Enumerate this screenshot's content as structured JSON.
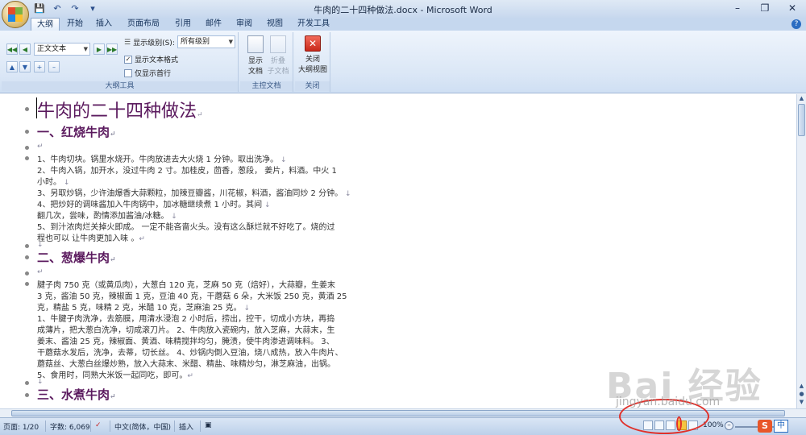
{
  "window": {
    "title": "牛肉的二十四种做法.docx - Microsoft Word",
    "qat": [
      "save-icon",
      "undo-icon",
      "redo-icon",
      "customize-icon"
    ]
  },
  "tabs": [
    "大纲",
    "开始",
    "插入",
    "页面布局",
    "引用",
    "邮件",
    "审阅",
    "视图",
    "开发工具"
  ],
  "ribbon": {
    "outline_tools": {
      "label": "大纲工具",
      "level_combo": "正文文本",
      "show_level_label": "显示级别(S):",
      "show_level_value": "所有级别",
      "show_text_format": "显示文本格式",
      "show_first_line": "仅显示首行"
    },
    "master_document": {
      "label": "主控文档",
      "show_document_line1": "显示",
      "show_document_line2": "文档",
      "collapse_line1": "折叠",
      "collapse_line2": "子文档"
    },
    "close": {
      "label": "关闭",
      "close_outline_line1": "关闭",
      "close_outline_line2": "大纲视图"
    }
  },
  "document": {
    "title": "牛肉的二十四种做法",
    "section1_heading": "一、红烧牛肉",
    "section1_lines": [
      "1、牛肉切块。锅里水烧开。牛肉放进去大火烧 1 分钟。取出洗净。",
      "2、牛肉入锅，加开水，没过牛肉 2 寸。加桂皮，茴香，葱段， 姜片，料酒。中火 1",
      "小时。",
      "3、另取炒锅，少许油爆香大蒜颗粒，加辣豆瓣酱，川花椒，料酒，酱油同炒 2 分钟。",
      "4、把炒好的调味酱加入牛肉锅中，加冰糖继续煮 1 小时。其间",
      "翻几次，尝味，酌情添加酱油/冰糖。",
      "5、到汁浓肉烂关掉火即成。 一定不能吝啬火头。没有这么酥烂就不好吃了。烧的过",
      "程也可以 让牛肉更加入味 。"
    ],
    "section2_heading": "二、葱爆牛肉",
    "section2_lines": [
      "腱子肉 750 克（或黄瓜肉），大葱白 120 克，芝麻 50 克（焙好），大蒜瓣，生姜末",
      "3 克，酱油 50 克，辣椒面 1 克，豆油 40 克，干蘑菇 6 朵，大米饭 250 克，黄酒 25",
      "克，精盐 5 克，味精 2 克，米醋 10 克，芝麻油 25 克。",
      "1、牛腱子肉洗净，去筋膜，用清水浸泡 2 小时后，捞出，控干，切成小方块，再捣",
      "成薄片，把大葱白洗净，切成滚刀片。 2、牛肉放入瓷碗内，放入芝麻，大蒜末，生",
      "姜末、酱油 25 克，辣椒面、黄酒、味精搅拌均匀，腌渍，使牛肉渗进调味料。 3、",
      "干蘑菇水发后，洗净，去蒂，切长丝。 4、炒锅内倒入豆油，烧八成热，放入牛肉片、",
      "蘑菇丝、大葱白丝爆炒熟，放入大蒜末、米醋、精盐、味精炒匀，淋芝麻油，出锅。",
      "5、食用时，同熟大米饭一起同吃，即可。"
    ],
    "section3_heading": "三、水煮牛肉"
  },
  "status": {
    "page": "页面: 1/20",
    "words": "字数: 6,069",
    "language": "中文(简体，中国)",
    "insert": "插入",
    "zoom": "100%",
    "ime_s": "S",
    "ime_zh": "中"
  },
  "watermark": {
    "main": "Bai 经验",
    "sub": "jingyan.baidu.com"
  }
}
